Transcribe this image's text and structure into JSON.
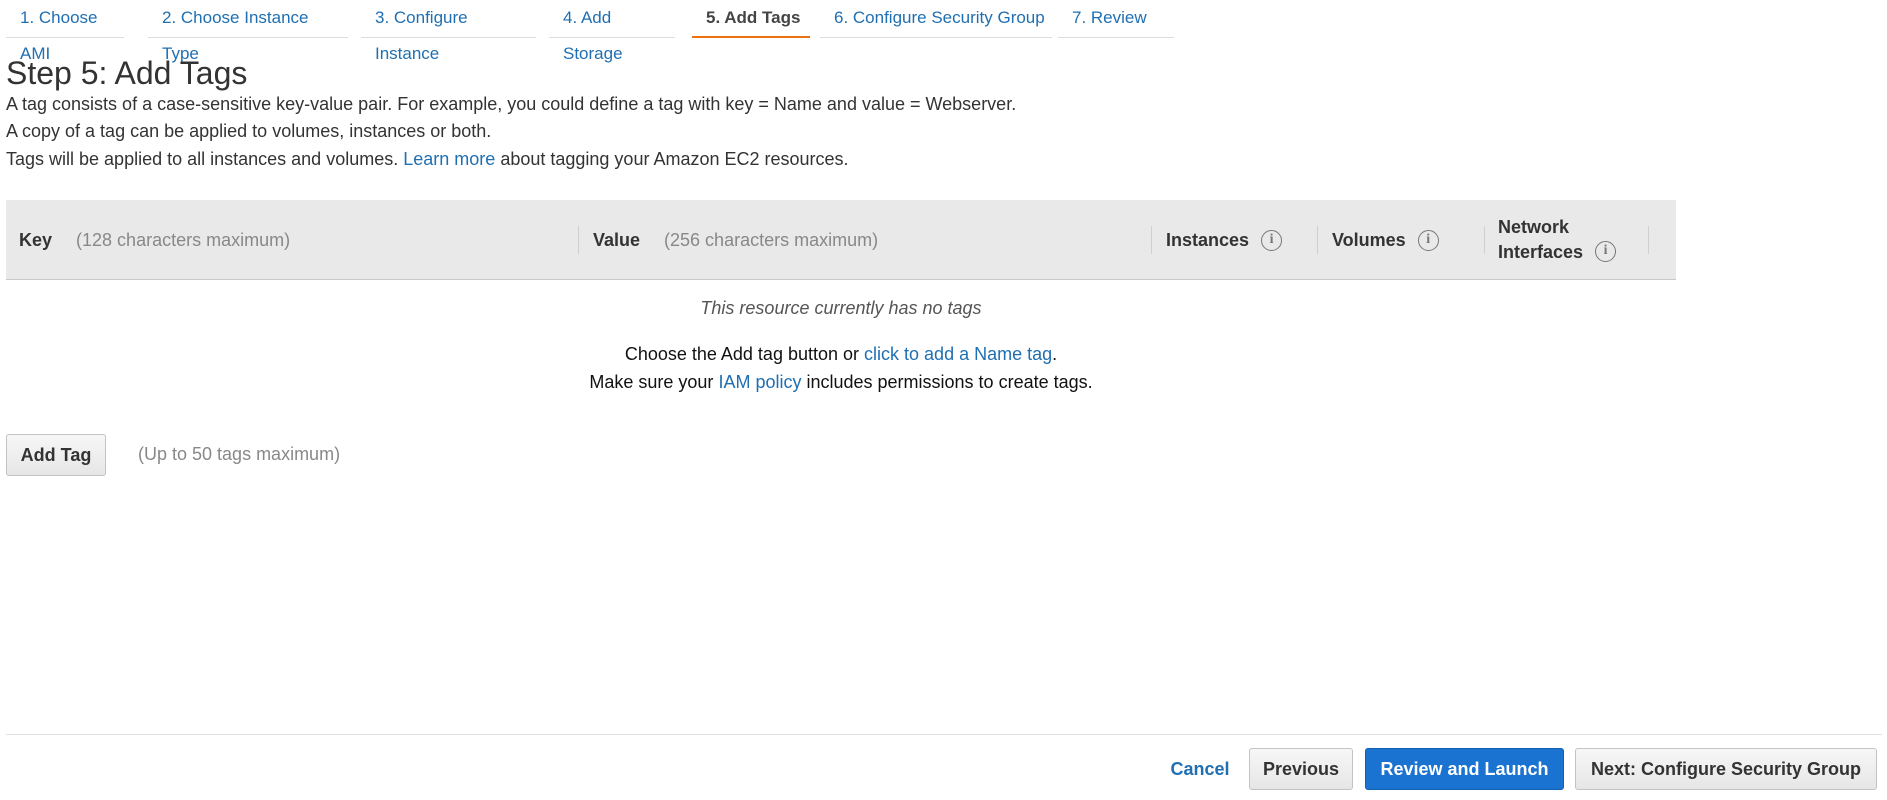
{
  "wizard": {
    "steps": [
      {
        "label": "1. Choose AMI"
      },
      {
        "label": "2. Choose Instance Type"
      },
      {
        "label": "3. Configure Instance"
      },
      {
        "label": "4. Add Storage"
      },
      {
        "label": "5. Add Tags",
        "active": true
      },
      {
        "label": "6. Configure Security Group"
      },
      {
        "label": "7. Review"
      }
    ]
  },
  "page": {
    "title": "Step 5: Add Tags",
    "desc1": "A tag consists of a case-sensitive key-value pair. For example, you could define a tag with key = Name and value = Webserver.",
    "desc2": "A copy of a tag can be applied to volumes, instances or both.",
    "desc3_pre": "Tags will be applied to all instances and volumes.",
    "desc3_link": "Learn more",
    "desc3_post": "about tagging your Amazon EC2 resources."
  },
  "table": {
    "key_header": "Key",
    "key_hint": "(128 characters maximum)",
    "value_header": "Value",
    "value_hint": "(256 characters maximum)",
    "instances_header": "Instances",
    "volumes_header": "Volumes",
    "network_header_line1": "Network",
    "network_header_line2": "Interfaces",
    "info_glyph": "i",
    "empty_message": "This resource currently has no tags"
  },
  "guidance": {
    "line1_pre": "Choose the Add tag button or",
    "line1_link": "click to add a Name tag",
    "line1_post": ".",
    "line2_pre": "Make sure your",
    "line2_link": "IAM policy",
    "line2_post": "includes permissions to create tags."
  },
  "add_tag": {
    "button_label": "Add Tag",
    "hint": "(Up to 50 tags maximum)"
  },
  "footer": {
    "cancel": "Cancel",
    "previous": "Previous",
    "review_launch": "Review and Launch",
    "next": "Next: Configure Security Group"
  },
  "colors": {
    "link": "#1f6fb2",
    "active_tab_underline": "#ec7211",
    "primary_button": "#1a73d1",
    "table_header_bg": "#e9e9e9"
  }
}
